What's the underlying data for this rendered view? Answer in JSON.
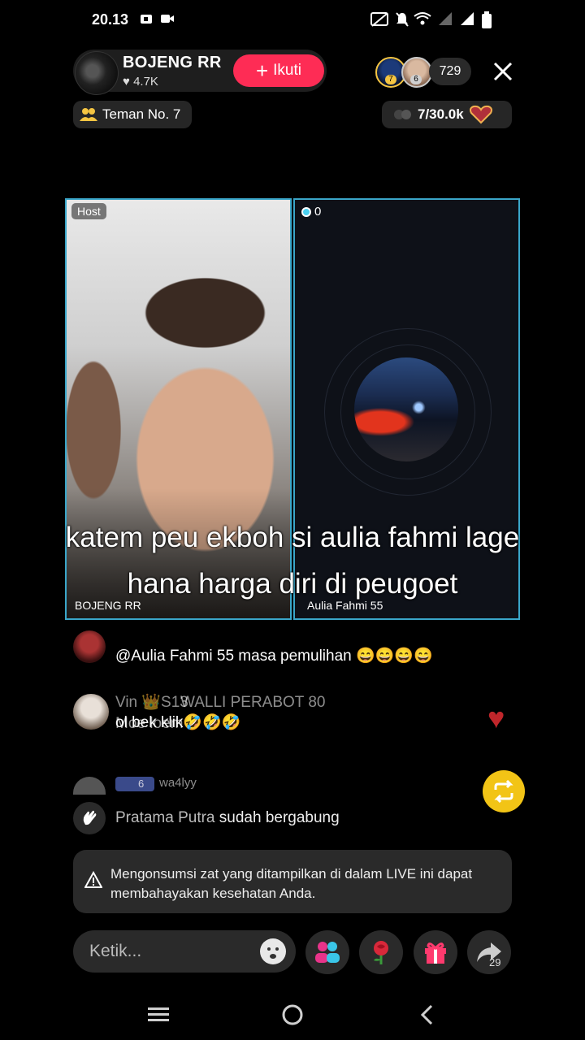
{
  "status_bar": {
    "time": "20.13"
  },
  "host": {
    "name": "BOJENG RR",
    "likes": "4.7K",
    "follow_label": "Ikuti"
  },
  "viewers": {
    "badge_1": "7",
    "badge_2": "6",
    "count": "729"
  },
  "teman_label": "Teman No. 7",
  "rank_progress": "7/30.0k",
  "battle": {
    "host_tag": "Host",
    "guest_score": "0",
    "host_label": "BOJENG RR",
    "guest_label": "Aulia Fahmi 55"
  },
  "caption": "katem peu ekboh si aulia fahmi lage hana harga diri di peugoet",
  "comments": {
    "mention_text": "@Aulia Fahmi 55 masa pemulihan 😄😄😄😄",
    "row2_name_a": "Vin 👑S13",
    "row2_name_b": "WALLI PERABOT 80",
    "row2_text_a": "ol bek klik🤣🤣🤣",
    "row2_text_b": "Moe loem",
    "row3_badge": "6",
    "row3_name": "wa4lyy",
    "join_name": "Pratama Putra",
    "join_text": "sudah bergabung"
  },
  "warning_text": "Mengonsumsi zat yang ditampilkan di dalam LIVE ini dapat membahayakan kesehatan Anda.",
  "chat": {
    "placeholder": "Ketik..."
  },
  "share_count": "29",
  "colors": {
    "accent": "#fe2c55",
    "border": "#3aa6c9",
    "repost": "#f2c416"
  }
}
